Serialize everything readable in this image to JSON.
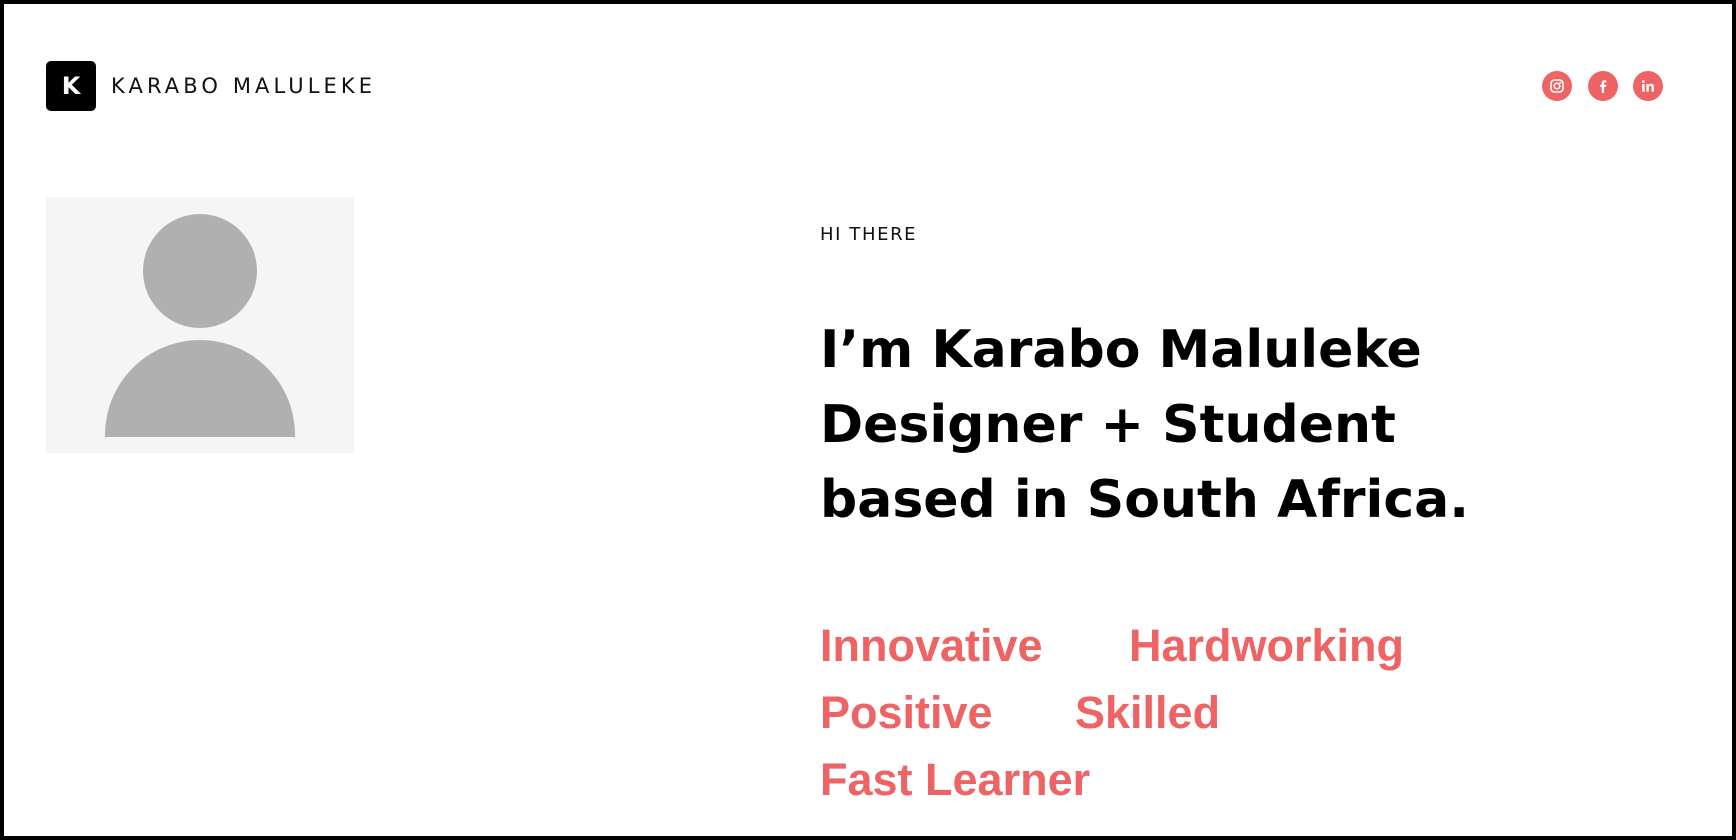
{
  "brand": {
    "logo_letter": "K",
    "name": "KARABO MALULEKE"
  },
  "social": {
    "accent_color": "#ee6464",
    "icons": [
      "instagram-icon",
      "facebook-icon",
      "linkedin-icon"
    ]
  },
  "hero": {
    "eyebrow": "HI THERE",
    "headline_lines": [
      "I’m Karabo Maluleke",
      "Designer + Student",
      "based in South Africa."
    ],
    "traits": [
      "Innovative",
      "Hardworking",
      "Positive",
      "Skilled",
      "Fast Learner"
    ]
  },
  "avatar": {
    "placeholder_color": "#b0b0b0",
    "background_color": "#f5f5f5"
  }
}
